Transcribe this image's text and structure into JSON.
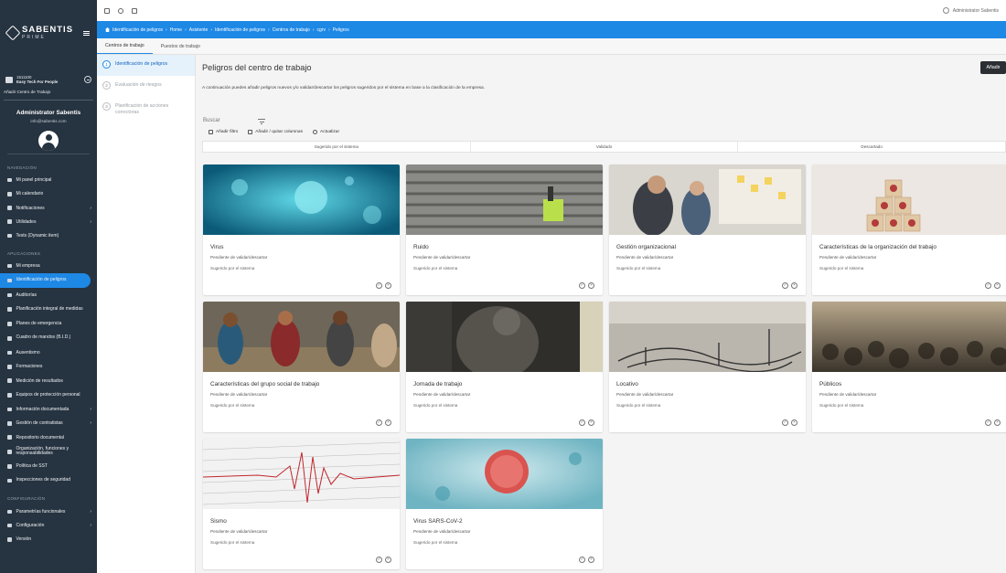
{
  "brand": {
    "name": "SABENTIS",
    "sub": "PRIME"
  },
  "company": {
    "id": "1511100",
    "name": "Easy Tech For People",
    "add_label": "Añadir Centro de Trabajo"
  },
  "user": {
    "name": "Administrator Sabentis",
    "email": "info@sabentis.com"
  },
  "nav": {
    "section_navigation": "NAVEGACIÓN",
    "navigation_items": [
      {
        "label": "Mi panel principal",
        "chevron": ""
      },
      {
        "label": "Mi calendario",
        "chevron": ""
      },
      {
        "label": "Notificaciones",
        "chevron": "›"
      },
      {
        "label": "Utilidades",
        "chevron": "›"
      },
      {
        "label": "Tests (Dynamic item)",
        "chevron": ""
      }
    ],
    "section_applications": "APLICACIONES",
    "application_items": [
      {
        "label": "Mi empresa",
        "chevron": ""
      },
      {
        "label": "Identificación de peligros",
        "chevron": ""
      },
      {
        "label": "Auditorías",
        "chevron": ""
      },
      {
        "label": "Planificación integral de medidas",
        "chevron": ""
      },
      {
        "label": "Planes de emergencia",
        "chevron": ""
      },
      {
        "label": "Cuadro de mandos (B.I.D.)",
        "chevron": ""
      },
      {
        "label": "Ausentismo",
        "chevron": ""
      },
      {
        "label": "Formaciones",
        "chevron": ""
      },
      {
        "label": "Medición de resultados",
        "chevron": ""
      },
      {
        "label": "Equipos de protección personal",
        "chevron": ""
      },
      {
        "label": "Información documentada",
        "chevron": "›"
      },
      {
        "label": "Gestión de contratistas",
        "chevron": "›"
      },
      {
        "label": "Repositorio documental",
        "chevron": ""
      },
      {
        "label": "Organización, funciones y responsabilidades",
        "chevron": ""
      },
      {
        "label": "Política de SST",
        "chevron": ""
      },
      {
        "label": "Inspecciones de seguridad",
        "chevron": ""
      }
    ],
    "section_configuration": "CONFIGURACIÓN",
    "configuration_items": [
      {
        "label": "Parametrías funcionales",
        "chevron": "›"
      },
      {
        "label": "Configuración",
        "chevron": "›"
      },
      {
        "label": "Versión",
        "chevron": ""
      }
    ]
  },
  "topbar": {
    "user": "Administrator Sabentis"
  },
  "breadcrumb": [
    "Identificación de peligros",
    "Home",
    "Asistente",
    "Identificación de peligros",
    "Centros de trabajo",
    "cgrv",
    "Peligros"
  ],
  "tabs": [
    "Centros de trabajo",
    "Puestos de trabajo"
  ],
  "steps": [
    {
      "num": "1",
      "label": "Identificación de peligros"
    },
    {
      "num": "2",
      "label": "Evaluación de riesgos"
    },
    {
      "num": "3",
      "label": "Planificación de acciones correctoras"
    }
  ],
  "main": {
    "title": "Peligros del centro de trabajo",
    "add_button": "Añadir",
    "intro": "A continuación puedes añadir peligros nuevos y/o validar/descartar los peligros sugeridos por el sistema en base a la clasificación de la empresa.",
    "search_label": "Buscar",
    "tools": [
      "Añadir filtro",
      "Añadir / quitar columnas",
      "Actualizar"
    ],
    "filters": [
      "Sugerido por el sistema",
      "Validado",
      "Descartado"
    ]
  },
  "cards": [
    {
      "title": "Virus",
      "status": "Pendiente de validar/descartar",
      "suggested": "Sugerido por el sistema"
    },
    {
      "title": "Ruido",
      "status": "Pendiente de validar/descartar",
      "suggested": "Sugerido por el sistema"
    },
    {
      "title": "Gestión organizacional",
      "status": "Pendiente de validar/descartar",
      "suggested": "Sugerido por el sistema"
    },
    {
      "title": "Características de la organización del trabajo",
      "status": "Pendiente de validar/descartar",
      "suggested": "Sugerido por el sistema"
    },
    {
      "title": "Características del grupo social de trabajo",
      "status": "Pendiente de validar/descartar",
      "suggested": "Sugerido por el sistema"
    },
    {
      "title": "Jornada de trabajo",
      "status": "Pendiente de validar/descartar",
      "suggested": "Sugerido por el sistema"
    },
    {
      "title": "Locativo",
      "status": "Pendiente de validar/descartar",
      "suggested": "Sugerido por el sistema"
    },
    {
      "title": "Públicos",
      "status": "Pendiente de validar/descartar",
      "suggested": "Sugerido por el sistema"
    },
    {
      "title": "Sismo",
      "status": "Pendiente de validar/descartar",
      "suggested": "Sugerido por el sistema"
    },
    {
      "title": "Virus SARS-CoV-2",
      "status": "Pendiente de validar/descartar",
      "suggested": "Sugerido por el sistema"
    }
  ],
  "colors": {
    "sidebar": "#263340",
    "accent": "#1e88e5",
    "button_dark": "#2b2f33"
  }
}
